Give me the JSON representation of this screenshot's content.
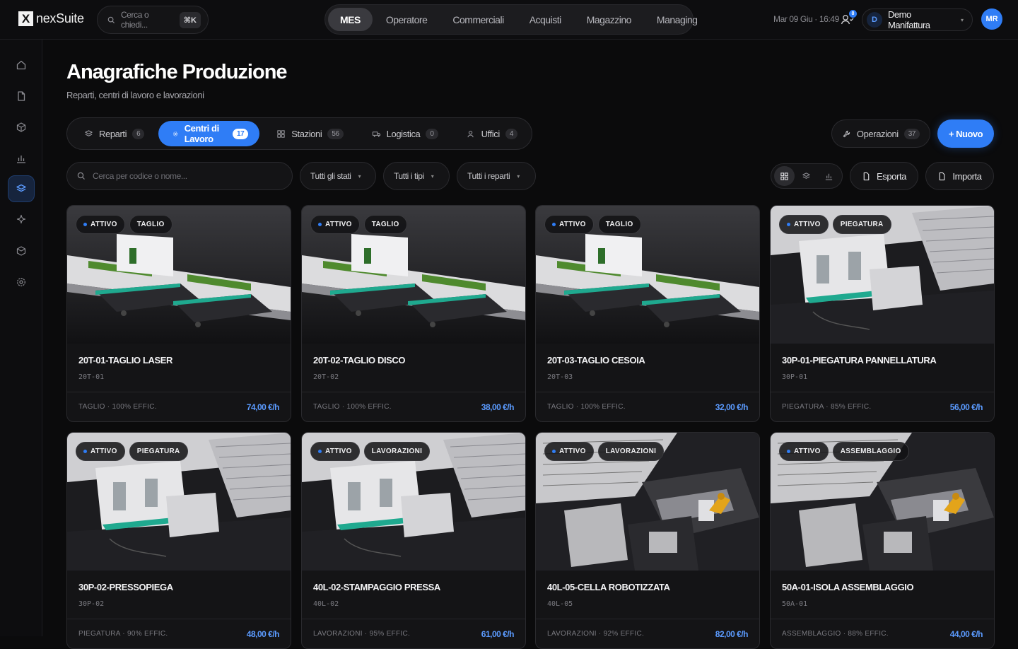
{
  "brand": {
    "logo_letter": "X",
    "name": "nexSuite"
  },
  "global_search": {
    "placeholder": "Cerca o chiedi...",
    "shortcut": "⌘K"
  },
  "main_nav": [
    {
      "label": "MES",
      "active": true
    },
    {
      "label": "Operatore"
    },
    {
      "label": "Commerciali"
    },
    {
      "label": "Acquisti"
    },
    {
      "label": "Magazzino"
    },
    {
      "label": "Managing"
    }
  ],
  "header": {
    "datetime": "Mar 09 Giu · 16:49",
    "notifications_count": "8",
    "org_initial": "D",
    "org_name": "Demo Manifattura",
    "user_initials": "MR"
  },
  "sidebar": [
    {
      "icon": "home-icon"
    },
    {
      "icon": "document-icon"
    },
    {
      "icon": "box-icon"
    },
    {
      "icon": "bar-chart-icon"
    },
    {
      "icon": "layers-icon",
      "active": true
    },
    {
      "icon": "sparkle-icon"
    },
    {
      "icon": "package-icon"
    },
    {
      "icon": "settings-icon"
    }
  ],
  "page": {
    "title": "Anagrafiche Produzione",
    "subtitle": "Reparti, centri di lavoro e lavorazioni"
  },
  "segments": [
    {
      "label": "Reparti",
      "count": "6",
      "icon": "layers-icon"
    },
    {
      "label": "Centri di Lavoro",
      "count": "17",
      "icon": "cog-icon",
      "active": true
    },
    {
      "label": "Stazioni",
      "count": "56",
      "icon": "grid-icon"
    },
    {
      "label": "Logistica",
      "count": "0",
      "icon": "truck-icon"
    },
    {
      "label": "Uffici",
      "count": "4",
      "icon": "users-icon"
    }
  ],
  "actions": {
    "operations_label": "Operazioni",
    "operations_count": "37",
    "new_label": "+ Nuovo",
    "export_label": "Esporta",
    "import_label": "Importa"
  },
  "filters": {
    "search_placeholder": "Cerca per codice o nome...",
    "state_label": "Tutti gli stati",
    "type_label": "Tutti i tipi",
    "dept_label": "Tutti i reparti"
  },
  "colors": {
    "accent": "#2f7df6",
    "rate": "#5b9bff",
    "machine_teal": "#1fa98f",
    "machine_green": "#6fd13a"
  },
  "cards": [
    {
      "status": "ATTIVO",
      "category": "TAGLIO",
      "title": "20T-01-TAGLIO LASER",
      "code": "20T-01",
      "meta": "TAGLIO · 100% EFFIC.",
      "rate": "74,00 €/h",
      "scene": "laser"
    },
    {
      "status": "ATTIVO",
      "category": "TAGLIO",
      "title": "20T-02-TAGLIO DISCO",
      "code": "20T-02",
      "meta": "TAGLIO · 100% EFFIC.",
      "rate": "38,00 €/h",
      "scene": "laser"
    },
    {
      "status": "ATTIVO",
      "category": "TAGLIO",
      "title": "20T-03-TAGLIO CESOIA",
      "code": "20T-03",
      "meta": "TAGLIO · 100% EFFIC.",
      "rate": "32,00 €/h",
      "scene": "laser"
    },
    {
      "status": "ATTIVO",
      "category": "PIEGATURA",
      "title": "30P-01-PIEGATURA PANNELLATURA",
      "code": "30P-01",
      "meta": "PIEGATURA · 85% EFFIC.",
      "rate": "56,00 €/h",
      "scene": "bend"
    },
    {
      "status": "ATTIVO",
      "category": "PIEGATURA",
      "title": "30P-02-PRESSOPIEGA",
      "code": "30P-02",
      "meta": "PIEGATURA · 90% EFFIC.",
      "rate": "48,00 €/h",
      "scene": "bend"
    },
    {
      "status": "ATTIVO",
      "category": "LAVORAZIONI",
      "title": "40L-02-STAMPAGGIO PRESSA",
      "code": "40L-02",
      "meta": "LAVORAZIONI · 95% EFFIC.",
      "rate": "61,00 €/h",
      "scene": "bend"
    },
    {
      "status": "ATTIVO",
      "category": "LAVORAZIONI",
      "title": "40L-05-CELLA ROBOTIZZATA",
      "code": "40L-05",
      "meta": "LAVORAZIONI · 92% EFFIC.",
      "rate": "82,00 €/h",
      "scene": "robot"
    },
    {
      "status": "ATTIVO",
      "category": "ASSEMBLAGGIO",
      "title": "50A-01-ISOLA ASSEMBLAGGIO",
      "code": "50A-01",
      "meta": "ASSEMBLAGGIO · 88% EFFIC.",
      "rate": "44,00 €/h",
      "scene": "robot"
    }
  ]
}
